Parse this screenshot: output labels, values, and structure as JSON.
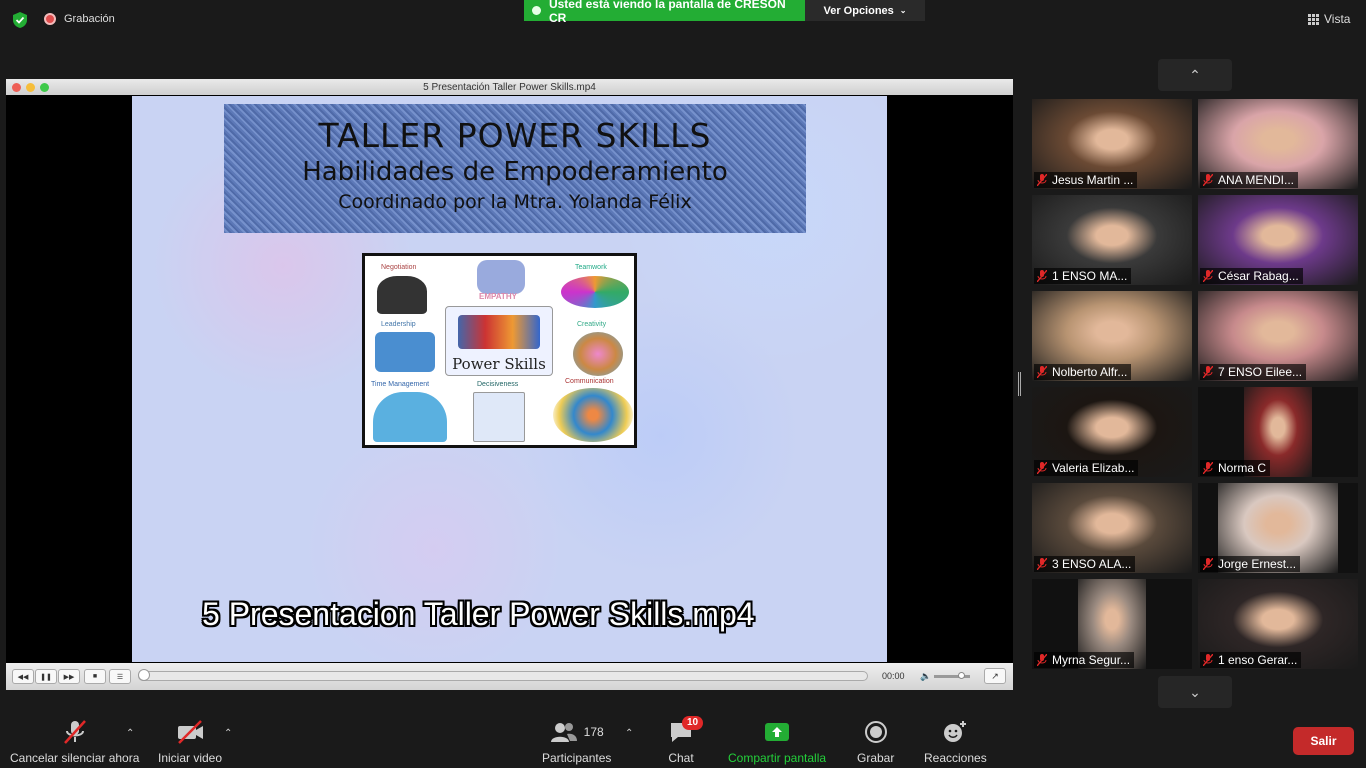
{
  "top": {
    "recording_label": "Grabación",
    "share_banner": "Usted está viendo la pantalla de CRESON CR",
    "view_options": "Ver Opciones",
    "view_label": "Vista"
  },
  "player": {
    "window_title": "5 Presentación Taller Power Skills.mp4",
    "caption": "5 Presentacion Taller Power Skills.mp4",
    "timecode": "00:00",
    "progress": 0,
    "slide": {
      "line1": "TALLER POWER SKILLS",
      "line2": "Habilidades de Empoderamiento",
      "line3": "Coordinado por la Mtra. Yolanda Félix",
      "center": "Power Skills",
      "empathy": "EMPATHY",
      "labels": [
        "Negotiation",
        "Teamwork",
        "Leadership",
        "Creativity",
        "Time Management",
        "Decisiveness",
        "Communication"
      ]
    }
  },
  "participants": [
    {
      "name": "Jesus Martin ...",
      "muted": true,
      "color": "#6b4a34"
    },
    {
      "name": "ANA MENDI...",
      "muted": true,
      "color": "#d9a4a8"
    },
    {
      "name": "1 ENSO MA...",
      "muted": true,
      "color": "#3a3a3a"
    },
    {
      "name": "César Rabag...",
      "muted": true,
      "color": "#6d3a8a"
    },
    {
      "name": "Nolberto Alfr...",
      "muted": true,
      "color": "#b89472"
    },
    {
      "name": "7 ENSO Eilee...",
      "muted": true,
      "color": "#c78a8c"
    },
    {
      "name": "Valeria Elizab...",
      "muted": true,
      "color": "#1c1612"
    },
    {
      "name": "Norma C",
      "muted": true,
      "color": "#8a2a2a"
    },
    {
      "name": "3 ENSO ALA...",
      "muted": true,
      "color": "#5a4a3c"
    },
    {
      "name": "Jorge Ernest...",
      "muted": true,
      "color": "#d9c8c0"
    },
    {
      "name": "Myrna Segur...",
      "muted": true,
      "color": "#9a8a80"
    },
    {
      "name": "1 enso Gerar...",
      "muted": true,
      "color": "#2e2626"
    }
  ],
  "toolbar": {
    "mute": "Cancelar silenciar ahora",
    "video": "Iniciar video",
    "participants_label": "Participantes",
    "participants_count": "178",
    "chat": "Chat",
    "chat_badge": "10",
    "share": "Compartir pantalla",
    "record": "Grabar",
    "reactions": "Reacciones",
    "leave": "Salir"
  },
  "colors": {
    "share_green": "#23ad34",
    "leave_red": "#c42a2a",
    "badge_red": "#e02828"
  }
}
